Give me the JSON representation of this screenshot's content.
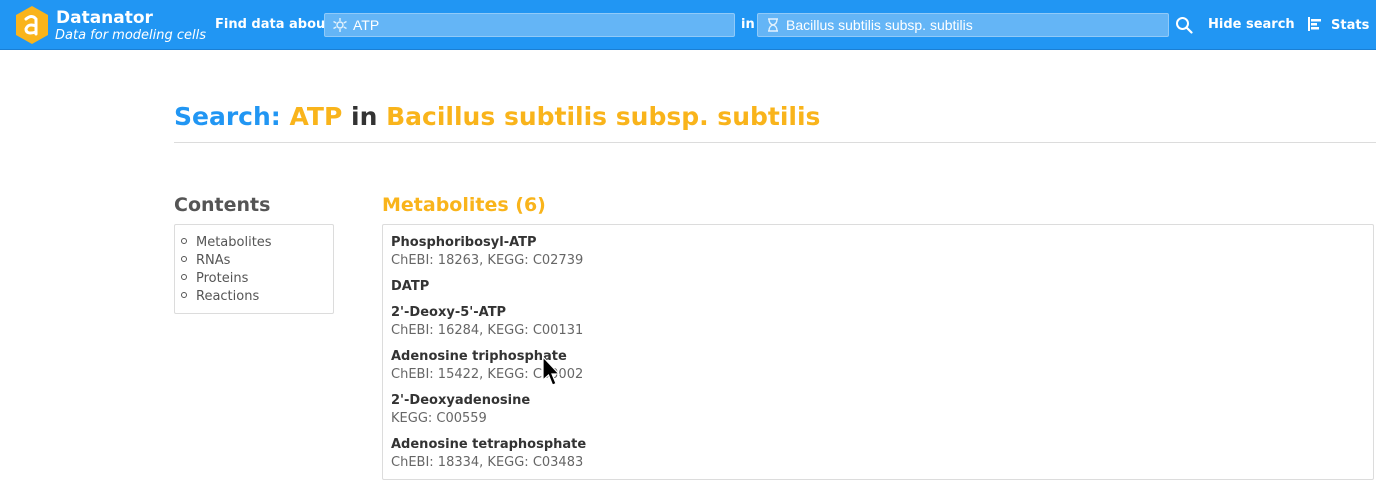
{
  "brand": {
    "name": "Datanator",
    "tagline": "Data for modeling cells"
  },
  "search": {
    "find_label": "Find data about",
    "query_value": "ATP",
    "in_label": "in",
    "organism_value": "Bacillus subtilis subsp. subtilis",
    "hide_label": "Hide search",
    "stats_label": "Stats"
  },
  "title": {
    "prefix": "Search:",
    "query": "ATP",
    "connector": "in",
    "organism": "Bacillus subtilis subsp. subtilis"
  },
  "contents": {
    "heading": "Contents",
    "items": [
      {
        "label": "Metabolites"
      },
      {
        "label": "RNAs"
      },
      {
        "label": "Proteins"
      },
      {
        "label": "Reactions"
      }
    ]
  },
  "metabolites": {
    "heading": "Metabolites (6)",
    "items": [
      {
        "name": "Phosphoribosyl-ATP",
        "ids": "ChEBI: 18263, KEGG: C02739"
      },
      {
        "name": "DATP",
        "ids": ""
      },
      {
        "name": "2'-Deoxy-5'-ATP",
        "ids": "ChEBI: 16284, KEGG: C00131"
      },
      {
        "name": "Adenosine triphosphate",
        "ids": "ChEBI: 15422, KEGG: C00002"
      },
      {
        "name": "2'-Deoxyadenosine",
        "ids": "KEGG: C00559"
      },
      {
        "name": "Adenosine tetraphosphate",
        "ids": "ChEBI: 18334, KEGG: C03483"
      }
    ]
  },
  "colors": {
    "navbar": "#2196f3",
    "accent_blue": "#2196f3",
    "accent_gold": "#f9b41b"
  },
  "icons": {
    "logo": "datanator-hexagon-logo",
    "query": "molecule-gear-icon",
    "organism": "hourglass-dna-icon",
    "search": "magnifier-icon",
    "stats": "bar-chart-icon"
  }
}
